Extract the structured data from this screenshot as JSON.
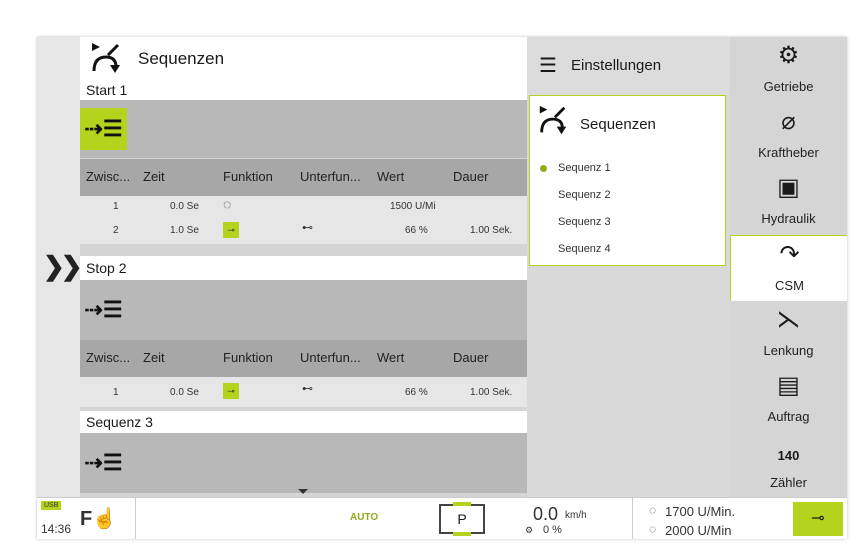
{
  "main": {
    "title": "Sequenzen",
    "sections": [
      {
        "label": "Start 1"
      },
      {
        "label": "Stop 2"
      },
      {
        "label": "Sequenz 3"
      }
    ],
    "columns": [
      "Zwisc...",
      "Zeit",
      "Funktion",
      "Unterfun...",
      "Wert",
      "Dauer"
    ],
    "section1_rows": [
      {
        "idx": "1",
        "zeit": "0.0 Se",
        "wert": "1500 U/Mi",
        "dauer": ""
      },
      {
        "idx": "2",
        "zeit": "1.0 Se",
        "wert": "66 %",
        "dauer": "1.00 Sek."
      }
    ],
    "section2_rows": [
      {
        "idx": "1",
        "zeit": "0.0 Se",
        "wert": "66 %",
        "dauer": "1.00 Sek."
      }
    ]
  },
  "middle": {
    "settings_label": "Einstellungen",
    "popup_title": "Sequenzen",
    "items": [
      "Sequenz 1",
      "Sequenz 2",
      "Sequenz 3",
      "Sequenz 4"
    ],
    "selected_index": 0
  },
  "nav": [
    {
      "label": "Getriebe",
      "icon": "gear-icon"
    },
    {
      "label": "Kraftheber",
      "icon": "hitch-icon"
    },
    {
      "label": "Hydraulik",
      "icon": "hydraulic-icon"
    },
    {
      "label": "CSM",
      "icon": "csm-icon"
    },
    {
      "label": "Lenkung",
      "icon": "steering-icon"
    },
    {
      "label": "Auftrag",
      "icon": "clipboard-icon"
    },
    {
      "label": "Zähler",
      "icon": "counter-icon"
    }
  ],
  "status": {
    "usb": "USB",
    "time": "14:36",
    "auto": "AUTO",
    "gear": "P",
    "speed": "0.0",
    "speed_unit": "km/h",
    "slip": "0 %",
    "rpm1": "1700 U/Min.",
    "rpm2": "2000 U/Min",
    "counter_digits": "140"
  },
  "colors": {
    "accent": "#b3d31d",
    "panel": "#d4d4d4"
  }
}
